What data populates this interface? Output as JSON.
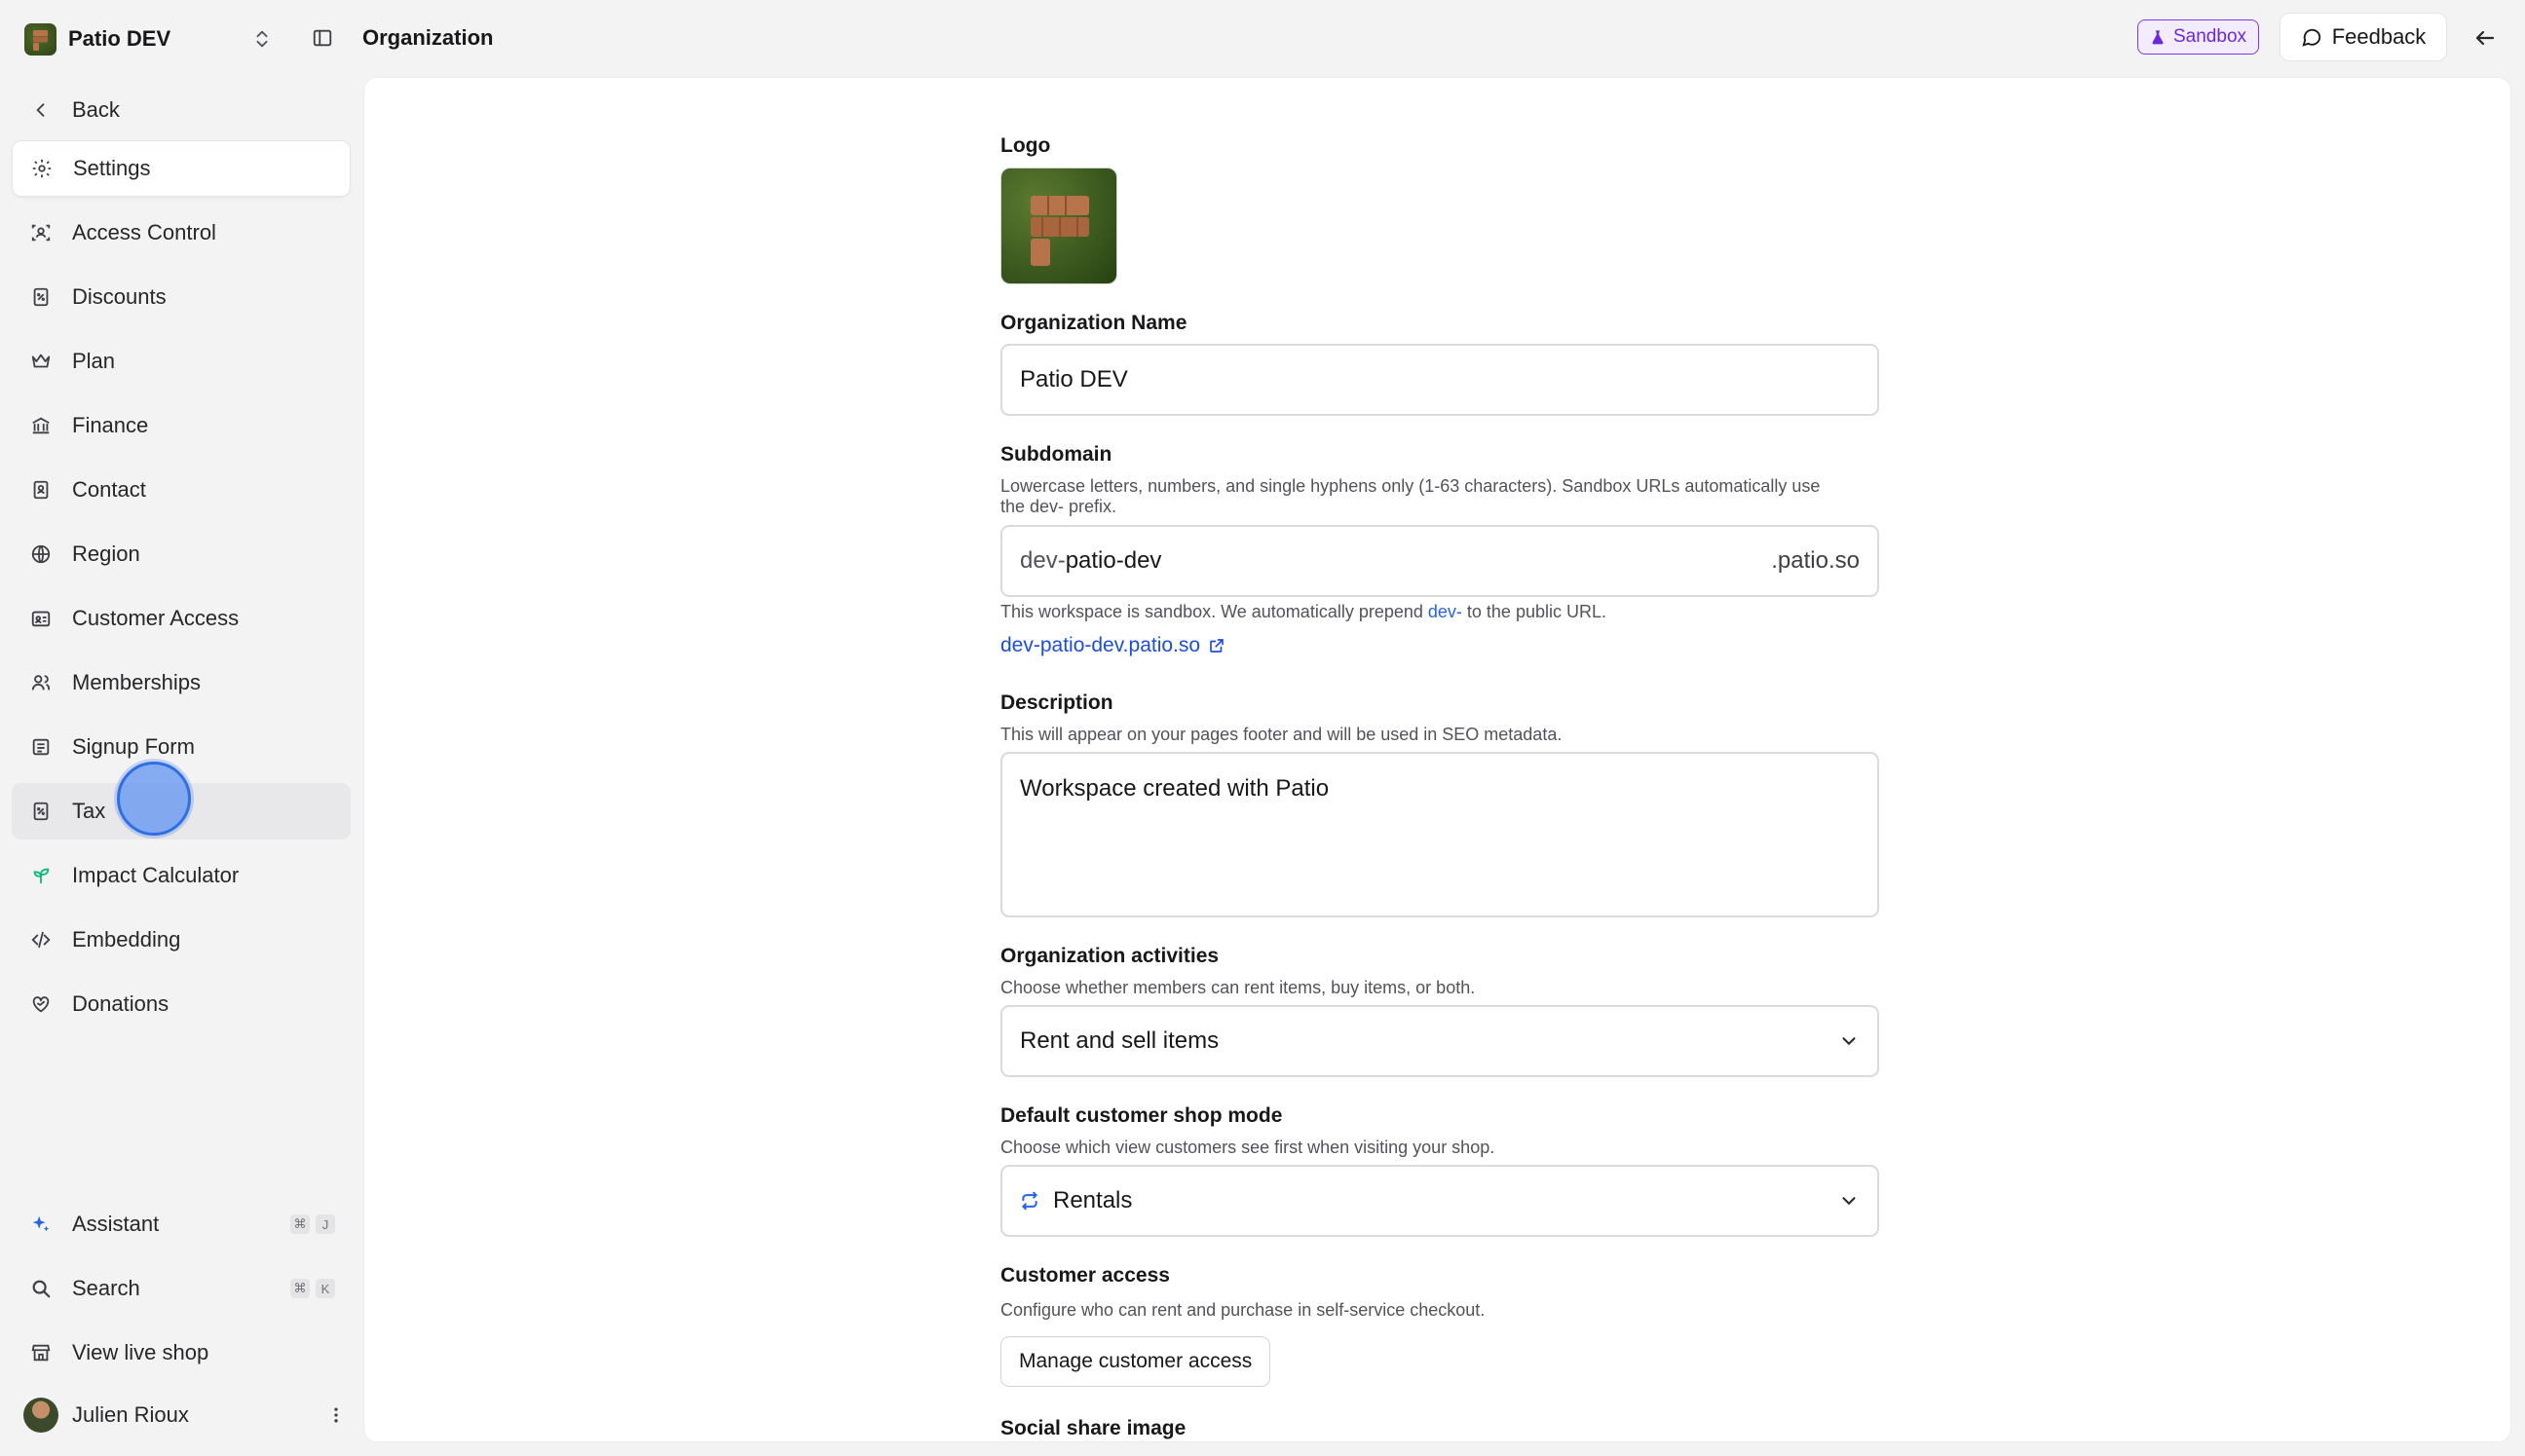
{
  "org": {
    "name": "Patio DEV"
  },
  "topbar": {
    "title": "Organization",
    "sandbox_label": "Sandbox",
    "feedback_label": "Feedback"
  },
  "sidebar": {
    "items": [
      {
        "label": "Back",
        "icon": "chevron-left-icon"
      },
      {
        "label": "Settings",
        "icon": "gear-icon"
      },
      {
        "label": "Access Control",
        "icon": "user-scan-icon"
      },
      {
        "label": "Discounts",
        "icon": "percent-receipt-icon"
      },
      {
        "label": "Plan",
        "icon": "crown-icon"
      },
      {
        "label": "Finance",
        "icon": "bank-icon"
      },
      {
        "label": "Contact",
        "icon": "contact-book-icon"
      },
      {
        "label": "Region",
        "icon": "globe-icon"
      },
      {
        "label": "Customer Access",
        "icon": "id-card-icon"
      },
      {
        "label": "Memberships",
        "icon": "users-icon"
      },
      {
        "label": "Signup Form",
        "icon": "form-icon"
      },
      {
        "label": "Tax",
        "icon": "tax-receipt-icon"
      },
      {
        "label": "Impact Calculator",
        "icon": "sprout-icon"
      },
      {
        "label": "Embedding",
        "icon": "code-icon"
      },
      {
        "label": "Donations",
        "icon": "heart-hand-icon"
      }
    ],
    "bottom": [
      {
        "label": "Assistant",
        "icon": "sparkles-icon",
        "kbd": [
          "⌘",
          "J"
        ]
      },
      {
        "label": "Search",
        "icon": "search-icon",
        "kbd": [
          "⌘",
          "K"
        ]
      },
      {
        "label": "View live shop",
        "icon": "store-icon"
      }
    ],
    "user": {
      "name": "Julien Rioux"
    }
  },
  "form": {
    "logo_label": "Logo",
    "org_name_label": "Organization Name",
    "org_name_value": "Patio DEV",
    "subdomain_label": "Subdomain",
    "subdomain_help_line1": "Lowercase letters, numbers, and single hyphens only (1-63 characters). Sandbox URLs automatically use",
    "subdomain_help_line2": "the dev- prefix.",
    "subdomain_prefix": "dev-",
    "subdomain_value": "patio-dev",
    "subdomain_suffix": ".patio.so",
    "sandbox_note_before": "This workspace is sandbox. We automatically prepend ",
    "sandbox_note_highlight": "dev-",
    "sandbox_note_after": " to the public URL.",
    "public_url": "dev-patio-dev.patio.so",
    "description_label": "Description",
    "description_help": "This will appear on your pages footer and will be used in SEO metadata.",
    "description_value": "Workspace created with Patio",
    "activities_label": "Organization activities",
    "activities_help": "Choose whether members can rent items, buy items, or both.",
    "activities_value": "Rent and sell items",
    "shop_mode_label": "Default customer shop mode",
    "shop_mode_help": "Choose which view customers see first when visiting your shop.",
    "shop_mode_value": "Rentals",
    "customer_access_label": "Customer access",
    "customer_access_help": "Configure who can rent and purchase in self-service checkout.",
    "customer_access_button": "Manage customer access",
    "social_image_label": "Social share image"
  },
  "colors": {
    "accent": "#2563eb",
    "sandbox": "#6d28d9",
    "impact_icon": "#10b981"
  }
}
